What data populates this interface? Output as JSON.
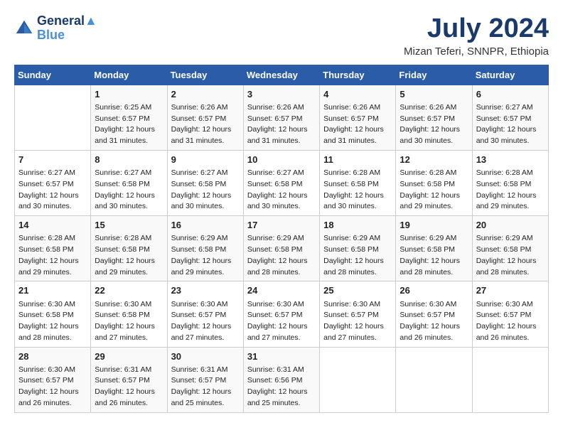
{
  "header": {
    "logo_line1": "General",
    "logo_line2": "Blue",
    "month_year": "July 2024",
    "location": "Mizan Teferi, SNNPR, Ethiopia"
  },
  "weekdays": [
    "Sunday",
    "Monday",
    "Tuesday",
    "Wednesday",
    "Thursday",
    "Friday",
    "Saturday"
  ],
  "weeks": [
    [
      {
        "day": "",
        "info": ""
      },
      {
        "day": "1",
        "info": "Sunrise: 6:25 AM\nSunset: 6:57 PM\nDaylight: 12 hours\nand 31 minutes."
      },
      {
        "day": "2",
        "info": "Sunrise: 6:26 AM\nSunset: 6:57 PM\nDaylight: 12 hours\nand 31 minutes."
      },
      {
        "day": "3",
        "info": "Sunrise: 6:26 AM\nSunset: 6:57 PM\nDaylight: 12 hours\nand 31 minutes."
      },
      {
        "day": "4",
        "info": "Sunrise: 6:26 AM\nSunset: 6:57 PM\nDaylight: 12 hours\nand 31 minutes."
      },
      {
        "day": "5",
        "info": "Sunrise: 6:26 AM\nSunset: 6:57 PM\nDaylight: 12 hours\nand 30 minutes."
      },
      {
        "day": "6",
        "info": "Sunrise: 6:27 AM\nSunset: 6:57 PM\nDaylight: 12 hours\nand 30 minutes."
      }
    ],
    [
      {
        "day": "7",
        "info": "Sunrise: 6:27 AM\nSunset: 6:57 PM\nDaylight: 12 hours\nand 30 minutes."
      },
      {
        "day": "8",
        "info": "Sunrise: 6:27 AM\nSunset: 6:58 PM\nDaylight: 12 hours\nand 30 minutes."
      },
      {
        "day": "9",
        "info": "Sunrise: 6:27 AM\nSunset: 6:58 PM\nDaylight: 12 hours\nand 30 minutes."
      },
      {
        "day": "10",
        "info": "Sunrise: 6:27 AM\nSunset: 6:58 PM\nDaylight: 12 hours\nand 30 minutes."
      },
      {
        "day": "11",
        "info": "Sunrise: 6:28 AM\nSunset: 6:58 PM\nDaylight: 12 hours\nand 30 minutes."
      },
      {
        "day": "12",
        "info": "Sunrise: 6:28 AM\nSunset: 6:58 PM\nDaylight: 12 hours\nand 29 minutes."
      },
      {
        "day": "13",
        "info": "Sunrise: 6:28 AM\nSunset: 6:58 PM\nDaylight: 12 hours\nand 29 minutes."
      }
    ],
    [
      {
        "day": "14",
        "info": "Sunrise: 6:28 AM\nSunset: 6:58 PM\nDaylight: 12 hours\nand 29 minutes."
      },
      {
        "day": "15",
        "info": "Sunrise: 6:28 AM\nSunset: 6:58 PM\nDaylight: 12 hours\nand 29 minutes."
      },
      {
        "day": "16",
        "info": "Sunrise: 6:29 AM\nSunset: 6:58 PM\nDaylight: 12 hours\nand 29 minutes."
      },
      {
        "day": "17",
        "info": "Sunrise: 6:29 AM\nSunset: 6:58 PM\nDaylight: 12 hours\nand 28 minutes."
      },
      {
        "day": "18",
        "info": "Sunrise: 6:29 AM\nSunset: 6:58 PM\nDaylight: 12 hours\nand 28 minutes."
      },
      {
        "day": "19",
        "info": "Sunrise: 6:29 AM\nSunset: 6:58 PM\nDaylight: 12 hours\nand 28 minutes."
      },
      {
        "day": "20",
        "info": "Sunrise: 6:29 AM\nSunset: 6:58 PM\nDaylight: 12 hours\nand 28 minutes."
      }
    ],
    [
      {
        "day": "21",
        "info": "Sunrise: 6:30 AM\nSunset: 6:58 PM\nDaylight: 12 hours\nand 28 minutes."
      },
      {
        "day": "22",
        "info": "Sunrise: 6:30 AM\nSunset: 6:58 PM\nDaylight: 12 hours\nand 27 minutes."
      },
      {
        "day": "23",
        "info": "Sunrise: 6:30 AM\nSunset: 6:57 PM\nDaylight: 12 hours\nand 27 minutes."
      },
      {
        "day": "24",
        "info": "Sunrise: 6:30 AM\nSunset: 6:57 PM\nDaylight: 12 hours\nand 27 minutes."
      },
      {
        "day": "25",
        "info": "Sunrise: 6:30 AM\nSunset: 6:57 PM\nDaylight: 12 hours\nand 27 minutes."
      },
      {
        "day": "26",
        "info": "Sunrise: 6:30 AM\nSunset: 6:57 PM\nDaylight: 12 hours\nand 26 minutes."
      },
      {
        "day": "27",
        "info": "Sunrise: 6:30 AM\nSunset: 6:57 PM\nDaylight: 12 hours\nand 26 minutes."
      }
    ],
    [
      {
        "day": "28",
        "info": "Sunrise: 6:30 AM\nSunset: 6:57 PM\nDaylight: 12 hours\nand 26 minutes."
      },
      {
        "day": "29",
        "info": "Sunrise: 6:31 AM\nSunset: 6:57 PM\nDaylight: 12 hours\nand 26 minutes."
      },
      {
        "day": "30",
        "info": "Sunrise: 6:31 AM\nSunset: 6:57 PM\nDaylight: 12 hours\nand 25 minutes."
      },
      {
        "day": "31",
        "info": "Sunrise: 6:31 AM\nSunset: 6:56 PM\nDaylight: 12 hours\nand 25 minutes."
      },
      {
        "day": "",
        "info": ""
      },
      {
        "day": "",
        "info": ""
      },
      {
        "day": "",
        "info": ""
      }
    ]
  ]
}
